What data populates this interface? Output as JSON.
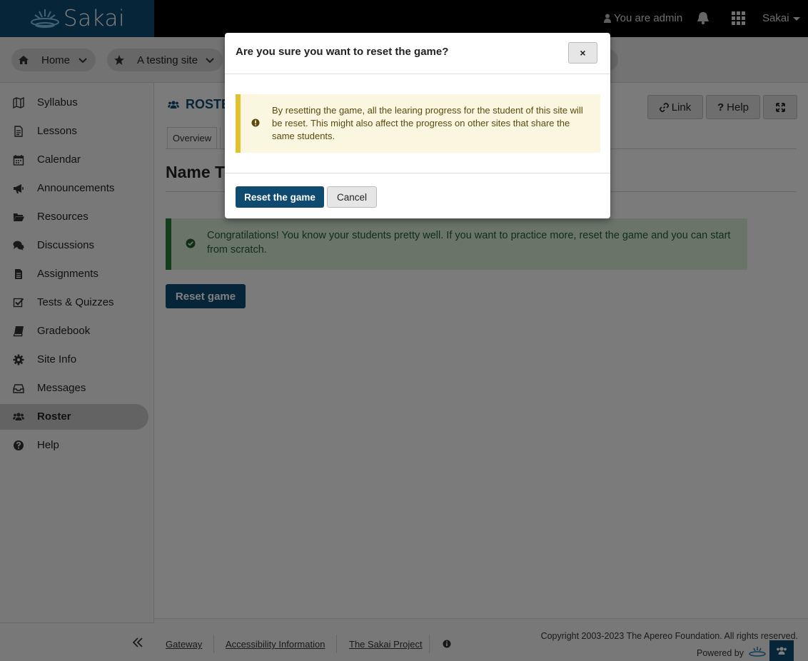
{
  "topbar": {
    "logo_text": "Sakai",
    "user_label": "You are admin",
    "site_menu": "Sakai"
  },
  "sitebar": {
    "pills": [
      {
        "label": "Home",
        "icon": "home-icon"
      },
      {
        "label": "A testing site",
        "icon": "star-icon"
      }
    ]
  },
  "sidebar": {
    "items": [
      {
        "label": "Syllabus",
        "icon": "map-icon"
      },
      {
        "label": "Lessons",
        "icon": "document-icon"
      },
      {
        "label": "Calendar",
        "icon": "calendar-icon"
      },
      {
        "label": "Announcements",
        "icon": "bullhorn-icon"
      },
      {
        "label": "Resources",
        "icon": "folder-icon"
      },
      {
        "label": "Discussions",
        "icon": "comments-icon"
      },
      {
        "label": "Assignments",
        "icon": "file-text-icon"
      },
      {
        "label": "Tests & Quizzes",
        "icon": "check-square-icon"
      },
      {
        "label": "Gradebook",
        "icon": "book-icon"
      },
      {
        "label": "Site Info",
        "icon": "gear-icon"
      },
      {
        "label": "Messages",
        "icon": "inbox-icon"
      },
      {
        "label": "Roster",
        "icon": "users-icon",
        "active": true
      },
      {
        "label": "Help",
        "icon": "question-circle-icon"
      }
    ]
  },
  "main": {
    "tool_title": "ROSTE",
    "buttons": {
      "link": "Link",
      "help": "Help"
    },
    "tab_overview": "Overview",
    "page_heading": "Name T",
    "success_message": "Congratilations! You know your students pretty well. If you want to practice more, reset the game and you can start from scratch.",
    "reset_button": "Reset game"
  },
  "footer": {
    "links": [
      "Gateway",
      "Accessibility Information",
      "The Sakai Project"
    ],
    "copyright": "Copyright 2003-2023 The Apereo Foundation. All rights reserved.",
    "powered_by": "Powered by"
  },
  "modal": {
    "title": "Are you sure you want to reset the game?",
    "close": "×",
    "warning": "By resetting the game, all the learing progress for the student of this site will be reset. This might also affect the progress on other sites that share the same students.",
    "confirm": "Reset the game",
    "cancel": "Cancel"
  },
  "colors": {
    "brand": "#0f4b70",
    "success_border": "#2b7a3a",
    "warning_border": "#e0c230"
  }
}
